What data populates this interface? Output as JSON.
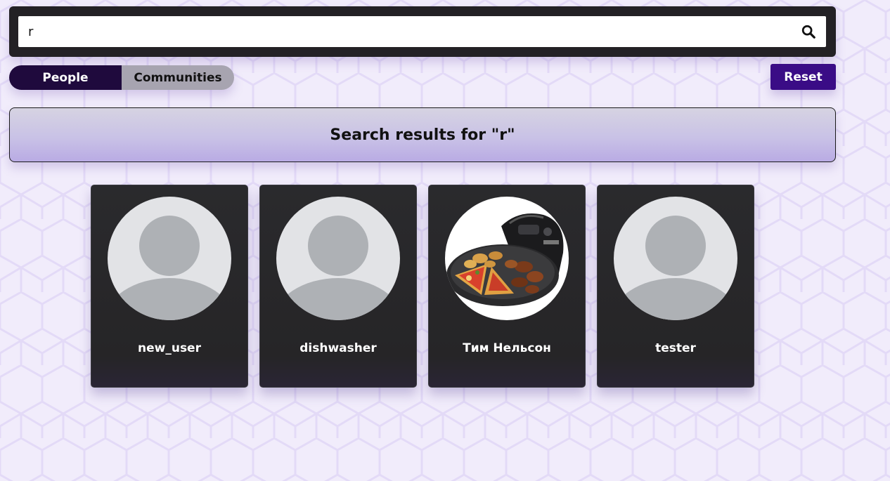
{
  "search": {
    "value": "r",
    "icon": "search-icon"
  },
  "tabs": {
    "people": "People",
    "communities": "Communities",
    "active": "People"
  },
  "reset_label": "Reset",
  "results": {
    "title": "Search results for \"r\""
  },
  "users": [
    {
      "name": "new_user",
      "avatar": "default-avatar-icon"
    },
    {
      "name": "dishwasher",
      "avatar": "default-avatar-icon"
    },
    {
      "name": "Тим Нельсон",
      "avatar": "pizza-oven-photo"
    },
    {
      "name": "tester",
      "avatar": "default-avatar-icon"
    }
  ],
  "colors": {
    "background": "#f1ecfb",
    "search_frame": "#232125",
    "toggle_active": "#1f0a3d",
    "toggle_inactive": "#a7a4b0",
    "reset": "#3a0c86",
    "card": "#282729"
  }
}
